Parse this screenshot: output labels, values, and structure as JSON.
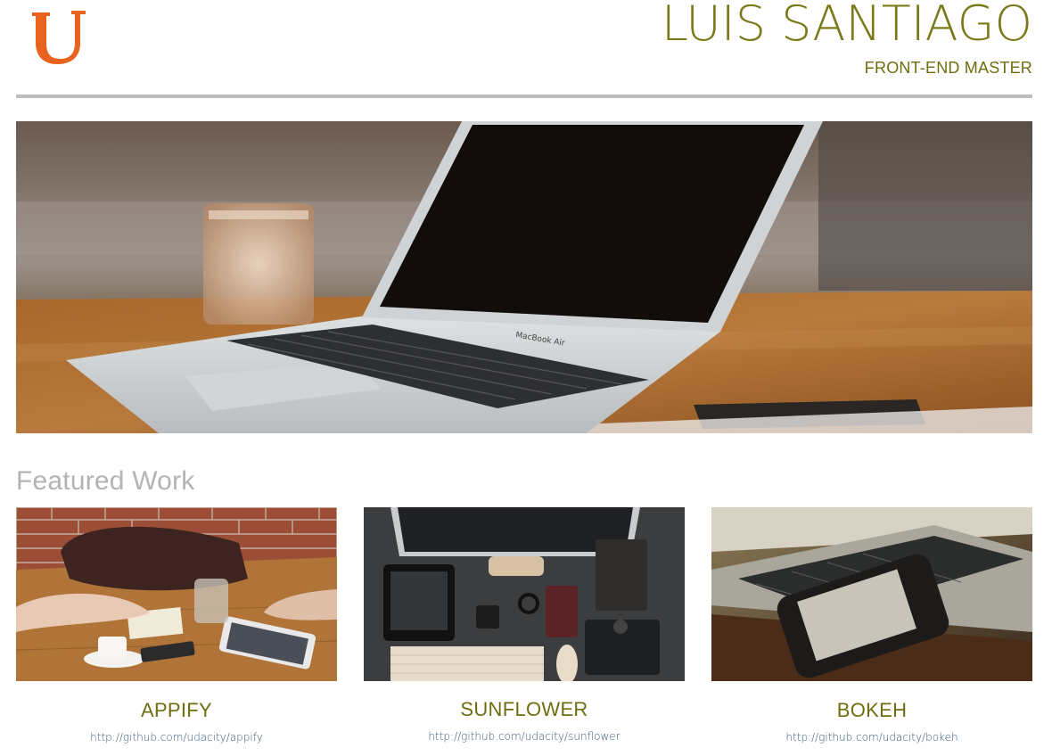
{
  "header": {
    "logo_letter": "U",
    "name": "LUIS SANTIAGO",
    "role": "FRONT-END MASTER"
  },
  "hero": {
    "laptop_label": "MacBook Air"
  },
  "featured": {
    "title": "Featured Work",
    "projects": [
      {
        "title": "APPIFY",
        "url": "http://github.com/udacity/appify"
      },
      {
        "title": "SUNFLOWER",
        "url": "http://github.com/udacity/sunflower"
      },
      {
        "title": "BOKEH",
        "url": "http://github.com/udacity/bokeh"
      }
    ]
  },
  "colors": {
    "logo": "#e8641e",
    "name": "#7a7a1a",
    "title": "#6e6e10",
    "link": "#3b5b7a",
    "muted_heading": "#b3b3b3",
    "rule": "#bdbdbd"
  }
}
